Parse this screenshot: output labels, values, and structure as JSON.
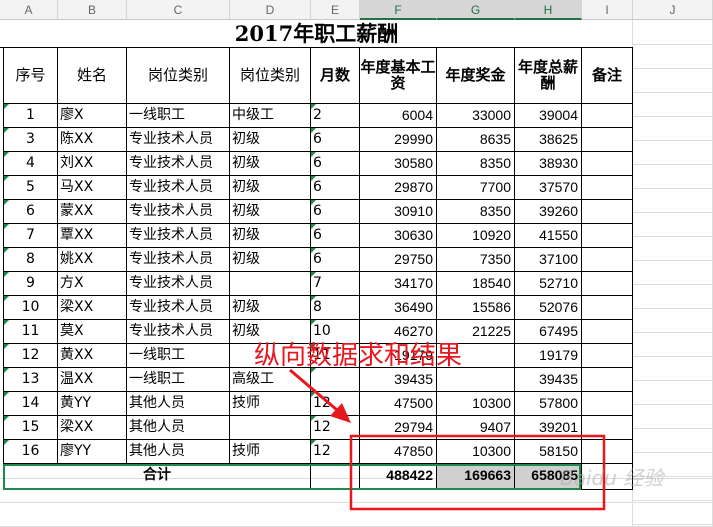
{
  "columns": [
    "A",
    "B",
    "C",
    "D",
    "E",
    "F",
    "G",
    "H",
    "I",
    "J"
  ],
  "title": "2017年职工薪酬",
  "headers": [
    "序号",
    "姓名",
    "岗位类别",
    "岗位类别",
    "月数",
    "年度基本工资",
    "年度奖金",
    "年度总薪酬",
    "备注"
  ],
  "rows": [
    [
      "1",
      "廖X",
      "一线职工",
      "中级工",
      "2",
      "6004",
      "33000",
      "39004",
      ""
    ],
    [
      "3",
      "陈XX",
      "专业技术人员",
      "初级",
      "6",
      "29990",
      "8635",
      "38625",
      ""
    ],
    [
      "4",
      "刘XX",
      "专业技术人员",
      "初级",
      "6",
      "30580",
      "8350",
      "38930",
      ""
    ],
    [
      "5",
      "马XX",
      "专业技术人员",
      "初级",
      "6",
      "29870",
      "7700",
      "37570",
      ""
    ],
    [
      "6",
      "蒙XX",
      "专业技术人员",
      "初级",
      "6",
      "30910",
      "8350",
      "39260",
      ""
    ],
    [
      "7",
      "覃XX",
      "专业技术人员",
      "初级",
      "6",
      "30630",
      "10920",
      "41550",
      ""
    ],
    [
      "8",
      "姚XX",
      "专业技术人员",
      "初级",
      "6",
      "29750",
      "7350",
      "37100",
      ""
    ],
    [
      "9",
      "方X",
      "专业技术人员",
      "",
      "7",
      "34170",
      "18540",
      "52710",
      ""
    ],
    [
      "10",
      "梁XX",
      "专业技术人员",
      "初级",
      "8",
      "36490",
      "15586",
      "52076",
      ""
    ],
    [
      "11",
      "莫X",
      "专业技术人员",
      "初级",
      "10",
      "46270",
      "21225",
      "67495",
      ""
    ],
    [
      "12",
      "黄XX",
      "一线职工",
      "",
      "11",
      "19179",
      "",
      "19179",
      ""
    ],
    [
      "13",
      "温XX",
      "一线职工",
      "高级工",
      "",
      "39435",
      "",
      "39435",
      ""
    ],
    [
      "14",
      "黄YY",
      "其他人员",
      "技师",
      "12",
      "47500",
      "10300",
      "57800",
      ""
    ],
    [
      "15",
      "梁XX",
      "其他人员",
      "",
      "12",
      "29794",
      "9407",
      "39201",
      ""
    ],
    [
      "16",
      "廖YY",
      "其他人员",
      "技师",
      "12",
      "47850",
      "10300",
      "58150",
      ""
    ]
  ],
  "total": {
    "label": "合计",
    "f": "488422",
    "g": "169663",
    "h": "658085"
  },
  "annotation": "纵向数据求和结果",
  "watermark": "Baidu 经验",
  "colors": {
    "annotation": "#e8171e",
    "selection": "#1e8a4c"
  }
}
